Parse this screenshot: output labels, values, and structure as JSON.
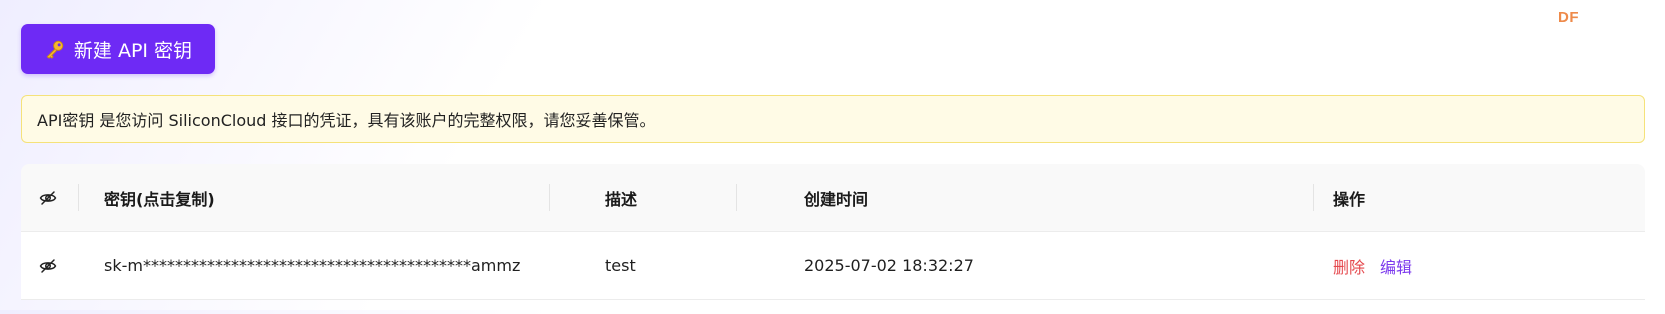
{
  "watermark": "DF",
  "toolbar": {
    "new_key_label": "新建 API 密钥",
    "new_key_icon": "key-icon"
  },
  "notice": {
    "text": "API密钥 是您访问 SiliconCloud 接口的凭证，具有该账户的完整权限，请您妥善保管。"
  },
  "table": {
    "columns": {
      "visibility_icon": "eye-off-icon",
      "key": "密钥(点击复制)",
      "description": "描述",
      "created_at": "创建时间",
      "actions": "操作"
    },
    "rows": [
      {
        "visibility_icon": "eye-off-icon",
        "key": "sk-m*****************************************ammz",
        "description": "test",
        "created_at": "2025-07-02 18:32:27",
        "delete_label": "删除",
        "edit_label": "编辑"
      }
    ]
  },
  "colors": {
    "primary": "#6e2af5",
    "notice_bg": "#fffbe6",
    "notice_border": "#f5e27a",
    "delete": "#e5484d",
    "edit": "#7c3aed",
    "watermark": "#ee8a4a"
  }
}
